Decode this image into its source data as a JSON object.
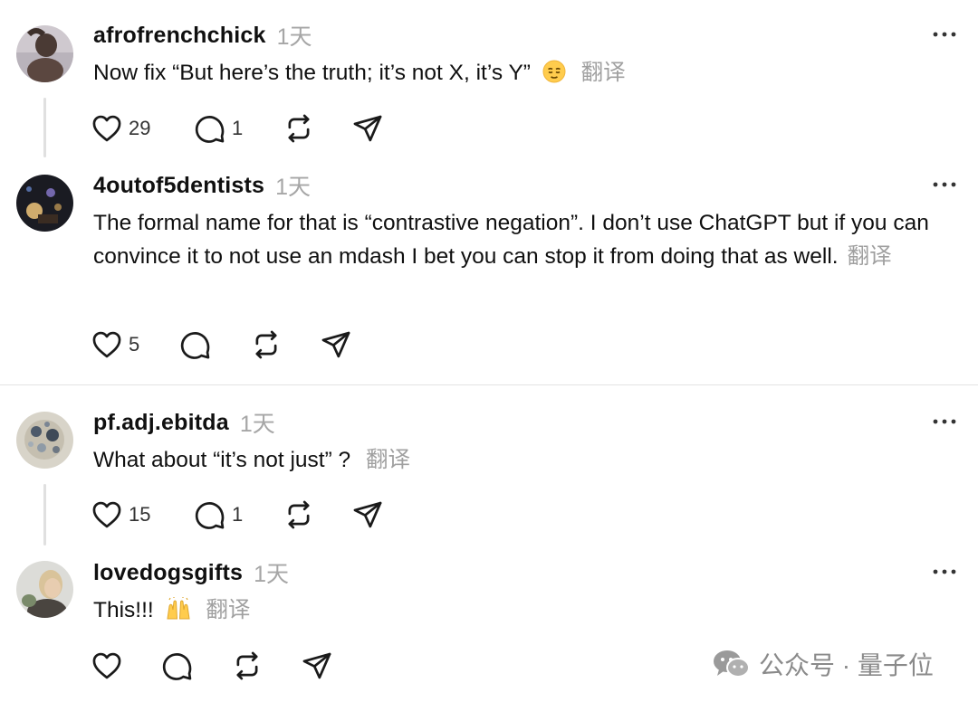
{
  "posts": [
    {
      "username": "afrofrenchchick",
      "time": "1天",
      "text": "Now fix “But here’s the truth; it’s not X, it’s Y”",
      "emoji": "relieved-face",
      "translate": "翻译",
      "likes": "29",
      "replies": "1"
    },
    {
      "username": "4outof5dentists",
      "time": "1天",
      "text": "The formal name for that is “contrastive negation”. I don’t use ChatGPT but if you can convince it to not use an mdash I bet you can stop it from doing that as well.",
      "translate": "翻译",
      "likes": "5",
      "replies": ""
    },
    {
      "username": "pf.adj.ebitda",
      "time": "1天",
      "text": "What about “it’s not just” ?",
      "translate": "翻译",
      "likes": "15",
      "replies": "1"
    },
    {
      "username": "lovedogsgifts",
      "time": "1天",
      "text": "This!!!",
      "emoji": "raising-hands",
      "translate": "翻译",
      "likes": "",
      "replies": ""
    }
  ],
  "watermark": {
    "text": "公众号 · 量子位",
    "icon": "wechat-icon"
  },
  "colors": {
    "text": "#101010",
    "muted": "#a6a6a6",
    "divider": "#e3e3e3"
  }
}
